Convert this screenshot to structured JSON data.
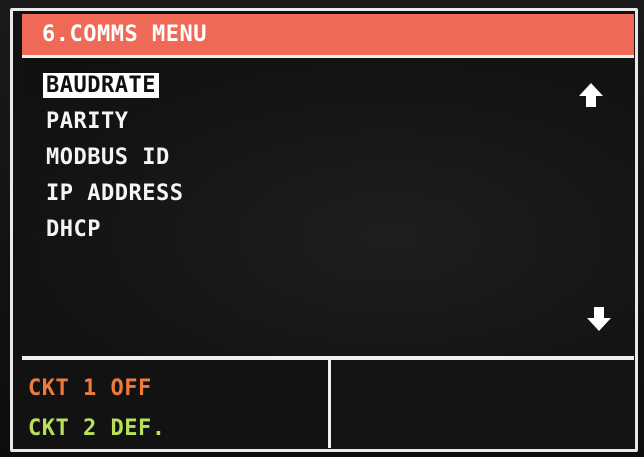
{
  "header": {
    "title": "6.COMMS MENU"
  },
  "menu": {
    "items": [
      {
        "label": "BAUDRATE",
        "selected": true
      },
      {
        "label": "PARITY",
        "selected": false
      },
      {
        "label": "MODBUS ID",
        "selected": false
      },
      {
        "label": "IP ADDRESS",
        "selected": false
      },
      {
        "label": "DHCP",
        "selected": false
      }
    ],
    "scroll_up_icon": "arrow-up-icon",
    "scroll_down_icon": "arrow-down-icon"
  },
  "status": {
    "line1": {
      "text": "CKT 1 OFF",
      "color": "#f07a3c"
    },
    "line2": {
      "text": "CKT 2 DEF.",
      "color": "#b8e05a"
    }
  },
  "colors": {
    "title_bar": "#ee6a57",
    "background": "#121212",
    "text": "#f5f5f5"
  }
}
